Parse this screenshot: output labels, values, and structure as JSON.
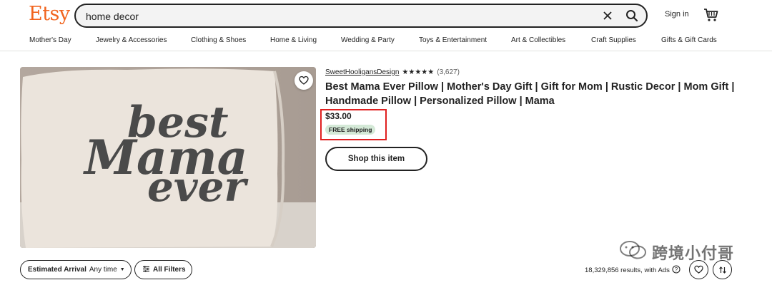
{
  "header": {
    "logo": "Etsy",
    "search": {
      "value": "home decor",
      "placeholder": "Search for anything"
    },
    "sign_in": "Sign in",
    "accent_color": "#f1641e"
  },
  "categories": [
    "Mother's Day",
    "Jewelry & Accessories",
    "Clothing & Shoes",
    "Home & Living",
    "Wedding & Party",
    "Toys & Entertainment",
    "Art & Collectibles",
    "Craft Supplies",
    "Gifts & Gift Cards"
  ],
  "listing": {
    "image_text": {
      "line1": "best",
      "line2": "Mama",
      "line3": "ever"
    },
    "shop_name": "SweetHooligansDesign",
    "stars": "★★★★★",
    "rating_count": "(3,627)",
    "title": "Best Mama Ever Pillow | Mother's Day Gift | Gift for Mom | Rustic Decor | Mom Gift | Handmade Pillow | Personalized Pillow | Mama",
    "price": "$33.00",
    "shipping_badge": "FREE shipping",
    "shop_button": "Shop this item",
    "highlight_color": "#e02020"
  },
  "filters": {
    "estimated_arrival_label": "Estimated Arrival",
    "estimated_arrival_value": "Any time",
    "all_filters": "All Filters",
    "results_text": "18,329,856 results, with Ads"
  },
  "watermark": {
    "text": "跨境小付哥"
  }
}
